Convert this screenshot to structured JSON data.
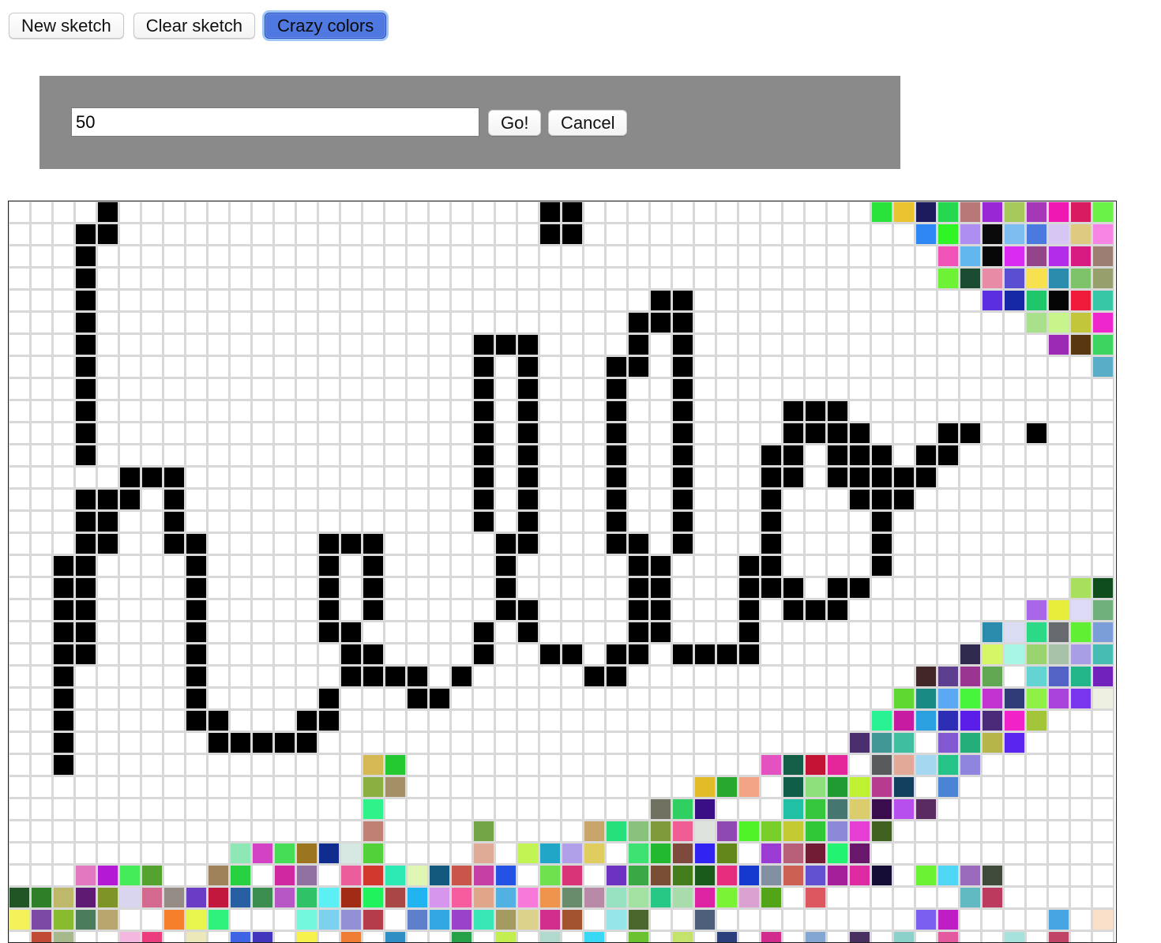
{
  "toolbar": {
    "new_label": "New sketch",
    "clear_label": "Clear sketch",
    "crazy_label": "Crazy colors"
  },
  "dialog": {
    "input_value": "50",
    "go_label": "Go!",
    "cancel_label": "Cancel"
  },
  "grid": {
    "columns": 50,
    "black_cells": "4:0,24:0,25:0,3:1,4:1,24:1,25:1,3:2,3:3,29:4,30:4,3:4,28:5,29:5,30:5,3:5,21:6,22:6,23:6,28:6,30:6,3:6,21:7,23:7,27:7,28:7,30:7,3:7,21:8,23:8,27:8,30:8,3:8,21:9,23:9,27:9,30:9,35:9,36:9,37:9,3:9,21:10,23:10,27:10,30:10,35:10,36:10,37:10,38:10,42:10,43:10,46:10,3:10,21:11,23:11,27:11,30:11,34:11,35:11,37:11,38:11,39:11,41:11,42:11,3:11,5:12,6:12,7:12,21:12,23:12,27:12,30:12,34:12,35:12,37:12,38:12,39:12,40:12,41:12,3:13,4:13,5:13,7:13,21:13,23:13,27:13,30:13,34:13,38:13,39:13,40:13,3:14,4:14,7:14,21:14,23:14,27:14,30:14,34:14,39:14,3:15,4:15,7:15,8:15,14:15,15:15,16:15,22:15,23:15,27:15,28:15,30:15,34:15,39:15,2:16,3:16,8:16,14:16,16:16,22:16,28:16,29:16,33:16,34:16,39:16,2:17,3:17,8:17,14:17,16:17,22:17,28:17,29:17,33:17,34:17,35:17,37:17,38:17,2:18,3:18,8:18,14:18,16:18,22:18,23:18,28:18,29:18,33:18,35:18,36:18,37:18,2:19,3:19,8:19,14:19,15:19,21:19,23:19,28:19,29:19,33:19,2:20,3:20,8:20,15:20,16:20,21:20,24:20,25:20,27:20,28:20,30:20,31:20,32:20,33:20,2:21,8:21,15:21,16:21,17:21,18:21,20:21,26:21,27:21,2:22,8:22,14:22,18:22,19:22,2:23,8:23,9:23,13:23,14:23,2:24,9:24,10:24,11:24,12:24,13:24,2:25",
    "color_cells": "39:0:#29e33a,40:0:#e9c430,41:0:#1b1b5e,42:0:#26d84f,43:0:#b87878,44:0:#9a27d6,45:0:#a6c95a,46:0:#a638b8,47:0:#ef18b3,48:0:#d91c61,49:0:#6bf249,41:1:#2f86f5,42:1:#2ff526,43:1:#ae8ef0,44:1:#0a0a0a,45:1:#7ebdf0,46:1:#4a7ae0,47:1:#d6c6f3,48:1:#dfca82,49:1:#f684e3,42:2:#f052b7,43:2:#62b7ef,44:2:#070707,45:2:#d92bf2,46:2:#94458a,47:2:#b12be8,48:2:#d81b83,49:2:#9c7f72,42:3:#6df235,43:3:#1b4b30,44:3:#e88ba6,45:3:#5a4fd3,46:3:#f7e14e,47:3:#2b8bad,48:3:#7ec36a,49:3:#97a06c,44:4:#5b2ee1,45:4:#1628a6,46:4:#1fc66a,47:4:#050505,48:4:#f01b3a,49:4:#37c6a6,46:5:#a9e08c,47:5:#c8f58b,48:5:#c1c63a,49:5:#ee27cc,47:6:#9c2ab5,48:6:#593711,49:6:#3ed460,49:7:#5aadc7,48:17:#a8e05e,49:17:#0f4d1c,46:18:#a966e8,47:18:#e8ec3b,48:18:#dddaf5,49:18:#6eaf7c,44:19:#2b8bac,45:19:#d9dcf2,46:19:#2bd986,47:19:#66696e,48:19:#60ef32,49:19:#7c9ed8,43:20:#302b4e,44:20:#d4f667,45:20:#a8f7e4,46:20:#99d46f,47:20:#a8c2a9,48:20:#a89ee6,49:20:#46bcb2,41:21:#412728,42:21:#5e3e8f,43:21:#9b3592,44:21:#62a852,46:21:#63d4d1,47:21:#5362c5,48:21:#22b58a,49:21:#7122bc,40:22:#5fd832,41:22:#1a8a85,42:22:#5ba9f5,43:22:#47f53c,44:22:#c134d2,45:22:#2f3c75,46:22:#8ff045,47:22:#a842d9,48:22:#7a36ef,49:22:#eef0e2,39:23:#28f291,40:23:#c71ba2,41:23:#2aa0e0,42:23:#2e2db5,43:23:#5b1de8,44:23:#4b2a7a,45:23:#f122c8,46:23:#a2c53a,38:24:#4b2e6e,39:24:#419795,40:24:#3fbfa0,42:24:#8158cf,43:24:#24ae7a,44:24:#b6b54a,45:24:#5a26ef,16:25:#d4b955,17:25:#24c830,34:25:#e452c2,35:25:#145e48,36:25:#c41436,37:25:#e5259a,39:25:#585a5b,40:25:#e2a898,41:25:#a5d8f0,42:25:#26c388,43:25:#8f85de,16:26:#8bb040,17:26:#a48f66,31:26:#e1bb28,32:26:#29a830,33:26:#f3a386,35:26:#0f5e48,36:26:#8ee07c,37:26:#1f9a31,38:26:#bef231,39:26:#b73b8e,40:26:#13405e,42:26:#4c84d5,16:27:#2ff38a,29:27:#707160,30:27:#2fcf61,31:27:#3a0f86,35:27:#20c0a4,36:27:#37c73f,37:27:#467670,38:27:#dccd6c,39:27:#3b0c4d,40:27:#b74fef,41:27:#5a2a63,16:28:#c08074,21:28:#73a446,26:28:#c8a66b,27:28:#26e07c,28:28:#89c27c,29:28:#7f9a3a,30:28:#f05c94,31:28:#dfe3de,32:28:#8f4ab1,33:28:#50f327,34:28:#78cf2a,35:28:#c4cb32,36:28:#30c837,37:28:#8c8ad8,38:28:#e73ed3,39:28:#40611f,10:29:#8ee8b6,11:29:#d341c5,12:29:#45dd56,13:29:#9c7520,14:29:#102c8e,15:29:#d7e8e2,16:29:#52d13a,21:29:#dfab96,23:29:#c2f553,24:29:#22a6c8,25:29:#b0a0ea,26:29:#dfcd5f,28:29:#3de272,29:29:#22b82f,30:29:#7e4a3e,31:29:#3124f2,32:29:#64871c,34:29:#9a3bd3,35:29:#b8607a,36:29:#731c35,37:29:#22f370,38:29:#6a186c,3:30:#e478c0,4:30:#b41ad6,5:30:#45ec5a,6:30:#54a32f,9:30:#a0825a,10:30:#28d142,12:30:#d029a0,13:30:#9071a2,15:30:#ec5d9b,16:30:#d3382c,17:30:#2deab2,18:30:#def5b3,19:30:#13597e,20:30:#c9564a,21:30:#c53fa4,22:30:#2452e4,24:30:#6fe14f,25:30:#d93477,27:30:#6e32c2,28:30:#3aa845,29:30:#794d33,30:30:#447e1c,31:30:#1a5a1a,32:30:#e62e7e,33:30:#1538ce,34:30:#8090a0,35:30:#cc6052,36:30:#6252d1,37:30:#a41f99,38:30:#de2ba3,39:30:#160d36,41:30:#6af233,42:30:#4fd6f4,43:30:#9a6abc,44:30:#404a3b,0:31:#225526,1:31:#2f7f28,2:31:#bdb86a,3:31:#5f1a74,4:31:#7f9427,5:31:#d9d5ee,6:31:#d3698e,7:31:#958b85,8:31:#6b3cc6,9:31:#c2183e,10:31:#285ea2,11:31:#3c8e50,12:31:#b756c5,13:31:#2fc267,14:31:#5cf0f4,15:31:#a12b14,16:31:#20f25e,17:31:#a94747,18:31:#20b4f0,19:31:#d696ee,20:31:#f65c9e,21:31:#e0a68a,22:31:#52b1e3,23:31:#f779d9,24:31:#ef944c,25:31:#688c6c,26:31:#b88aa7,27:31:#98e2c2,28:31:#a4e2a4,29:31:#27c886,30:31:#a8ddab,31:31:#dd23a1,32:31:#7af236,33:31:#dba1d0,34:31:#52a419,36:31:#dd5760,43:31:#61b9c1,44:31:#bb3a5d,0:32:#f4f25a,1:32:#7c4aa4,2:32:#88bc2e,3:32:#4a7c5b,4:32:#b8a66f,7:32:#f57f2a,8:32:#e8f54d,9:32:#2ef27b,13:32:#72f6dc,14:32:#7cd1ee,15:32:#9490d6,16:32:#b53d4a,18:32:#5d7fcc,19:32:#33a7e2,20:32:#9b42ca,21:32:#39e6b5,22:32:#a49b60,23:32:#ddd28b,24:32:#d02d8c,25:32:#a3532d,27:32:#94e6e8,28:32:#4c672e,31:32:#4e5f7c,41:32:#7b5ff0,42:32:#be1ec3,47:32:#48a5e4,49:32:#fae0c8,1:33:#c04a34,2:33:#a6b98c,5:33:#f4b8e0,6:33:#eb3d7d,8:33:#ede8ba,10:33:#3f63e5,11:33:#4236bd,13:33:#f7f14e,15:33:#f07d35,17:33:#2f8fc5,20:33:#26a148,22:33:#c3ee50,24:33:#b1d9ce,26:33:#39d8f5,28:33:#6ac230,30:33:#c4e36c,32:33:#2b3f7d,34:33:#d12b8d,36:33:#84a6d3,38:33:#4a3060,40:33:#8bd1c9,42:33:#e35a9f,45:33:#a7e3dc,47:33:#c04466"
  }
}
